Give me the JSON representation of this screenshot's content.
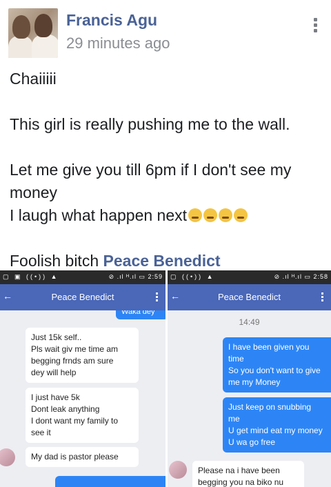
{
  "post": {
    "author": "Francis Agu",
    "time": "29 minutes ago",
    "lines": {
      "l1": "Chaiiiii",
      "l2": "This girl is really pushing me to the wall.",
      "l3": "Let me give you till 6pm if I don't see my money",
      "l4": "I laugh what happen next",
      "l5_prefix": "Foolish bitch",
      "l5_mention": "Peace Benedict"
    }
  },
  "left_screen": {
    "status_left": "▢ ▣ ((•)) ▲",
    "status_right": "⊘ .ıl ᴴ.ıl ▭ 2:59",
    "title": "Peace Benedict",
    "top_sent": "Waka dey",
    "bubble1": {
      "a": "Just 15k self..",
      "b": "Pls wait giv me time am",
      "c": "begging frnds am sure",
      "d": "dey will help"
    },
    "bubble2": {
      "a": "I just have 5k",
      "b": "Dont leak anything",
      "c": "I dont want my family to",
      "d": "see it"
    },
    "bubble3": "My dad is pastor please"
  },
  "right_screen": {
    "status_left": "▢ ((•)) ▲",
    "status_right": "⊘ .ıl ᴴ.ıl ▭ 2:58",
    "title": "Peace Benedict",
    "timestamp": "14:49",
    "sent1": {
      "a": "I have been given you",
      "b": "time",
      "c": "So you don't want to give",
      "d": "me my Money"
    },
    "sent2": {
      "a": "Just keep on snubbing",
      "b": "me",
      "c": "U get mind eat my money",
      "d": "U wa go free"
    },
    "recv1": {
      "a": "Please na i have been",
      "b": "begging you na biko nu"
    }
  }
}
